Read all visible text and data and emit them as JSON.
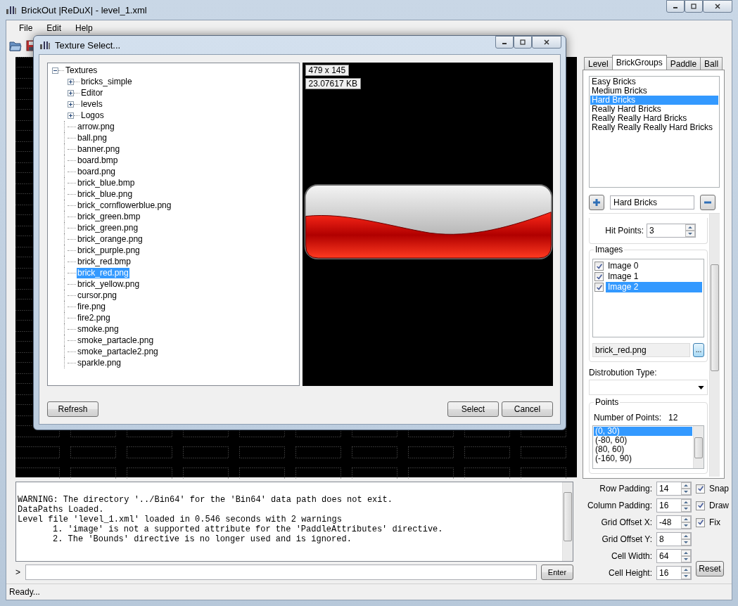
{
  "window": {
    "title": "BrickOut |ReDuX| - level_1.xml"
  },
  "menu": [
    "File",
    "Edit",
    "Help"
  ],
  "dialog": {
    "title": "Texture Select...",
    "tree": [
      {
        "label": "Textures",
        "kind": "folder",
        "expanded": true,
        "selected": false,
        "children": [
          {
            "label": "bricks_simple",
            "kind": "folder",
            "expanded": false,
            "selected": false
          },
          {
            "label": "Editor",
            "kind": "folder",
            "expanded": false,
            "selected": false
          },
          {
            "label": "levels",
            "kind": "folder",
            "expanded": false,
            "selected": false
          },
          {
            "label": "Logos",
            "kind": "folder",
            "expanded": false,
            "selected": false
          },
          {
            "label": "arrow.png",
            "kind": "file",
            "selected": false
          },
          {
            "label": "ball.png",
            "kind": "file",
            "selected": false
          },
          {
            "label": "banner.png",
            "kind": "file",
            "selected": false
          },
          {
            "label": "board.bmp",
            "kind": "file",
            "selected": false
          },
          {
            "label": "board.png",
            "kind": "file",
            "selected": false
          },
          {
            "label": "brick_blue.bmp",
            "kind": "file",
            "selected": false
          },
          {
            "label": "brick_blue.png",
            "kind": "file",
            "selected": false
          },
          {
            "label": "brick_cornflowerblue.png",
            "kind": "file",
            "selected": false
          },
          {
            "label": "brick_green.bmp",
            "kind": "file",
            "selected": false
          },
          {
            "label": "brick_green.png",
            "kind": "file",
            "selected": false
          },
          {
            "label": "brick_orange.png",
            "kind": "file",
            "selected": false
          },
          {
            "label": "brick_purple.png",
            "kind": "file",
            "selected": false
          },
          {
            "label": "brick_red.bmp",
            "kind": "file",
            "selected": false
          },
          {
            "label": "brick_red.png",
            "kind": "file",
            "selected": true
          },
          {
            "label": "brick_yellow.png",
            "kind": "file",
            "selected": false
          },
          {
            "label": "cursor.png",
            "kind": "file",
            "selected": false
          },
          {
            "label": "fire.png",
            "kind": "file",
            "selected": false
          },
          {
            "label": "fire2.png",
            "kind": "file",
            "selected": false
          },
          {
            "label": "smoke.png",
            "kind": "file",
            "selected": false
          },
          {
            "label": "smoke_partacle.png",
            "kind": "file",
            "selected": false
          },
          {
            "label": "smoke_partacle2.png",
            "kind": "file",
            "selected": false
          },
          {
            "label": "sparkle.png",
            "kind": "file",
            "selected": false
          }
        ]
      }
    ],
    "preview": {
      "dimensions": "479 x 145",
      "size": "23.07617 KB"
    },
    "left_buttons": [
      "Refresh"
    ],
    "right_buttons": [
      "Select",
      "Cancel"
    ]
  },
  "tabs": [
    {
      "label": "Level",
      "selected": false
    },
    {
      "label": "BrickGroups",
      "selected": true
    },
    {
      "label": "Paddle",
      "selected": false
    },
    {
      "label": "Ball",
      "selected": false
    }
  ],
  "brick_groups": [
    {
      "label": "Easy Bricks",
      "selected": false
    },
    {
      "label": "Medium Bricks",
      "selected": false
    },
    {
      "label": "Hard Bricks",
      "selected": true
    },
    {
      "label": "Really Hard Bricks",
      "selected": false
    },
    {
      "label": "Really Really Hard Bricks",
      "selected": false
    },
    {
      "label": "Really Really Really Hard Bricks",
      "selected": false
    }
  ],
  "group_name": "Hard Bricks",
  "hit_points": {
    "label": "Hit Points:",
    "value": "3"
  },
  "images": {
    "title": "Images",
    "items": [
      {
        "label": "Image 0",
        "checked": true,
        "selected": false
      },
      {
        "label": "Image 1",
        "checked": true,
        "selected": false
      },
      {
        "label": "Image 2",
        "checked": true,
        "selected": true
      }
    ],
    "file": "brick_red.png",
    "browse": "..."
  },
  "distribution": {
    "label": "Distrobution Type:"
  },
  "points": {
    "title": "Points",
    "count_label": "Number of Points:",
    "count": "12",
    "items": [
      {
        "label": "(0, 30)",
        "selected": true
      },
      {
        "label": "(-80, 60)",
        "selected": false
      },
      {
        "label": "(80, 60)",
        "selected": false
      },
      {
        "label": "(-160, 90)",
        "selected": false
      }
    ]
  },
  "grid_settings": [
    {
      "label": "Row Padding:",
      "value": "14"
    },
    {
      "label": "Column Padding:",
      "value": "16"
    },
    {
      "label": "Grid Offset X:",
      "value": "-48"
    },
    {
      "label": "Grid Offset Y:",
      "value": "8"
    },
    {
      "label": "Cell Width:",
      "value": "64"
    },
    {
      "label": "Cell Height:",
      "value": "16"
    }
  ],
  "options": [
    {
      "label": "Snap",
      "checked": true
    },
    {
      "label": "Draw",
      "checked": true
    },
    {
      "label": "Fix",
      "checked": true
    }
  ],
  "reset": "Reset",
  "console": [
    {
      "text": "WARNING: The directory '../Bin64' for the 'Bin64' data path does not exit.",
      "kind": "plain"
    },
    {
      "text": "DataPaths Loaded.",
      "kind": "plain"
    },
    {
      "text": "Level file 'level_1.xml' loaded in 0.546 seconds with 2 warnings",
      "kind": "plain"
    },
    {
      "text": "1. 'image' is not a supported attribute for the 'PaddleAttributes' directive.",
      "kind": "item"
    },
    {
      "text": "2. The 'Bounds' directive is no longer used and is ignored.",
      "kind": "item"
    }
  ],
  "prompt": ">",
  "enter": "Enter",
  "status": "Ready..."
}
